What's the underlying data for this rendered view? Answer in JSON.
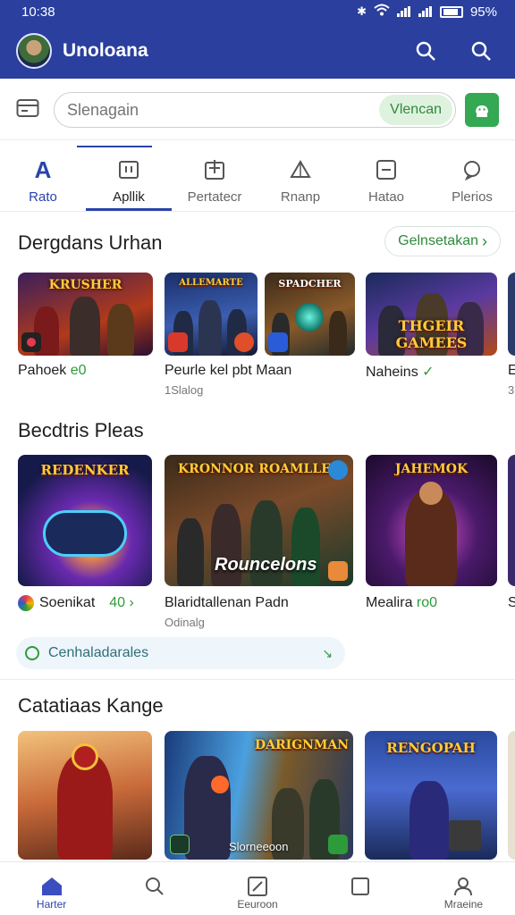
{
  "status_bar": {
    "time": "10:38",
    "battery": "95%"
  },
  "app_bar": {
    "title": "Unoloana"
  },
  "search": {
    "placeholder": "Slenagain",
    "chip_label": "Vlencan"
  },
  "tabs": [
    {
      "label": "Rato",
      "icon": "letter-a-icon"
    },
    {
      "label": "Apllik",
      "icon": "window-icon"
    },
    {
      "label": "Pertatecr",
      "icon": "add-box-icon"
    },
    {
      "label": "Rnanp",
      "icon": "triangle-icon"
    },
    {
      "label": "Hatao",
      "icon": "minus-box-icon"
    },
    {
      "label": "Plerios",
      "icon": "chat-icon"
    }
  ],
  "section1": {
    "title": "Dergdans Urhan",
    "action": "Gelnsetakan",
    "cards": [
      {
        "art_title": "KRUSHER",
        "title": "Pahoek",
        "title_suffix": "e0",
        "subtitle": ""
      },
      {
        "art_title": "ALLEMARTE",
        "title": "Peurle kel pbt Maan",
        "subtitle": "1Slalog"
      },
      {
        "art_title": "SPADCHER",
        "title": "",
        "subtitle": ""
      },
      {
        "art_title": "THGEIR GAMEES",
        "title": "Naheins",
        "title_suffix": "✓",
        "subtitle": ""
      },
      {
        "art_title": "",
        "title": "E",
        "subtitle": "3"
      }
    ]
  },
  "section2": {
    "title": "Becdtris Pleas",
    "cards": [
      {
        "art_title": "REDENKER",
        "title": "Soenikat",
        "title_suffix": "40 ›",
        "subtitle": ""
      },
      {
        "art_title": "KRONNOR ROAMLLES",
        "art_caption": "Rouncelons",
        "title": "Blaridtallenan Padn",
        "subtitle": "Odinalg"
      },
      {
        "art_title": "JAHEMOK",
        "title": "Mealira",
        "title_suffix": "ro0",
        "subtitle": ""
      },
      {
        "art_title": "",
        "title": "S",
        "subtitle": ""
      }
    ],
    "promo": {
      "label": "Cenhaladarales",
      "tail": "↘"
    }
  },
  "section3": {
    "title": "Catatiaas Kange",
    "cards": [
      {
        "art_title": ""
      },
      {
        "art_title": "DARIGNMAN",
        "art_caption": "Slorneeoon"
      },
      {
        "art_title": "RENGOPAH"
      }
    ]
  },
  "bottom_nav": [
    {
      "label": "Harter",
      "icon": "home-icon"
    },
    {
      "label": "",
      "icon": "search-icon"
    },
    {
      "label": "Eeuroon",
      "icon": "edit-icon"
    },
    {
      "label": "",
      "icon": "square-icon"
    },
    {
      "label": "Mraeine",
      "icon": "profile-icon"
    }
  ],
  "colors": {
    "brand": "#2a3f9e",
    "accent": "#2a44a8",
    "green": "#34a853"
  }
}
